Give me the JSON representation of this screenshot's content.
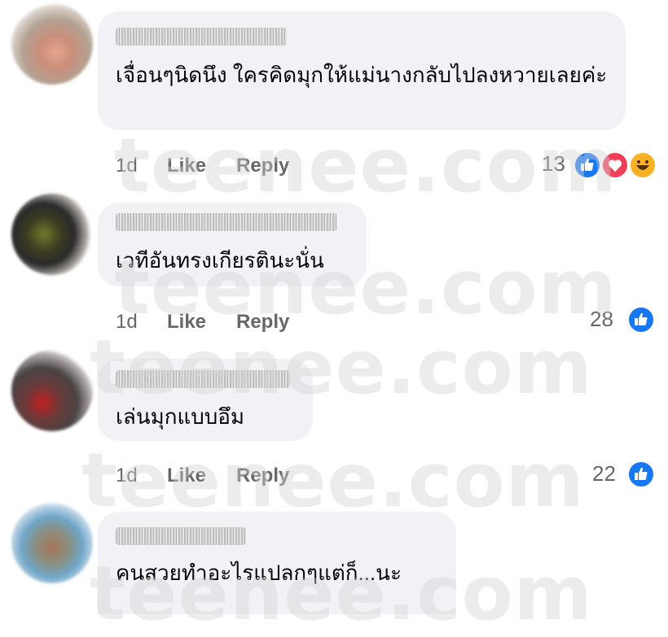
{
  "comments": [
    {
      "text": "เจื่อนๆนิดนึง ใครคิดมุกให้แม่นางกลับไปลงหวายเลยค่ะ",
      "time": "1d",
      "like": "Like",
      "reply": "Reply",
      "reaction_count": "13",
      "reactions": [
        "like-icon",
        "love-icon",
        "haha-icon"
      ]
    },
    {
      "text": "เวทีอันทรงเกียรตินะนั่น",
      "time": "1d",
      "like": "Like",
      "reply": "Reply",
      "reaction_count": "28",
      "reactions": [
        "like-icon"
      ]
    },
    {
      "text": "เล่นมุกแบบอึม",
      "time": "1d",
      "like": "Like",
      "reply": "Reply",
      "reaction_count": "22",
      "reactions": [
        "like-icon"
      ]
    },
    {
      "text": "คนสวยทำอะไรแปลกๆแต่ก็...นะ"
    }
  ],
  "watermark": "teenee.com",
  "colors": {
    "bubble": "#f0f2f5",
    "like_blue": "#1877f2",
    "love_red": "#f33e58",
    "haha_yellow": "#f7b125",
    "meta_gray": "#65676b"
  }
}
